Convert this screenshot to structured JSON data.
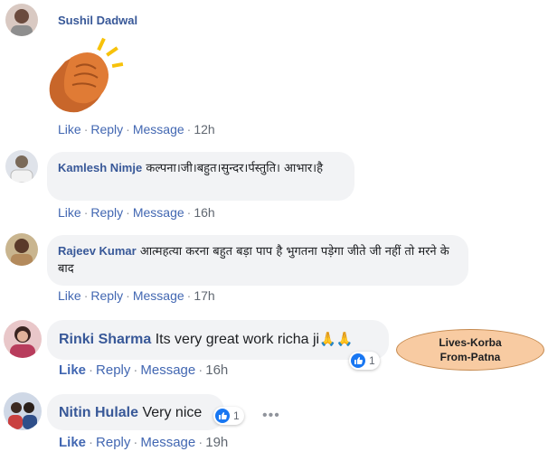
{
  "comments": [
    {
      "name": "Sushil Dadwal",
      "text": "",
      "actions": {
        "like": "Like",
        "reply": "Reply",
        "message": "Message",
        "time": "12h"
      },
      "sticker": "clapping-hands-icon"
    },
    {
      "name": "Kamlesh Nimje",
      "text": "कल्पना।जी।बहुत।सुन्दर।र्पस्तुति। आभार।है",
      "actions": {
        "like": "Like",
        "reply": "Reply",
        "message": "Message",
        "time": "16h"
      }
    },
    {
      "name": "Rajeev Kumar",
      "text": "आत्महत्या करना बहुत बड़ा पाप है भुगतना पड़ेगा जीते जी नहीं तो मरने के बाद",
      "actions": {
        "like": "Like",
        "reply": "Reply",
        "message": "Message",
        "time": "17h"
      }
    },
    {
      "name": "Rinki Sharma",
      "text": "Its very great work richa ji",
      "reaction_count": "1",
      "actions": {
        "like": "Like",
        "reply": "Reply",
        "message": "Message",
        "time": "16h"
      }
    },
    {
      "name": "Nitin Hulale",
      "text": "Very nice",
      "reaction_count": "1",
      "actions": {
        "like": "Like",
        "reply": "Reply",
        "message": "Message",
        "time": "19h"
      }
    }
  ],
  "annotation": {
    "line1": "Lives-Korba",
    "line2": "From-Patna"
  },
  "colors": {
    "name": "#385898",
    "link": "#4267b2",
    "bubble": "#f2f3f5",
    "callout_fill": "#f8cba2",
    "like_blue": "#1877f2"
  }
}
